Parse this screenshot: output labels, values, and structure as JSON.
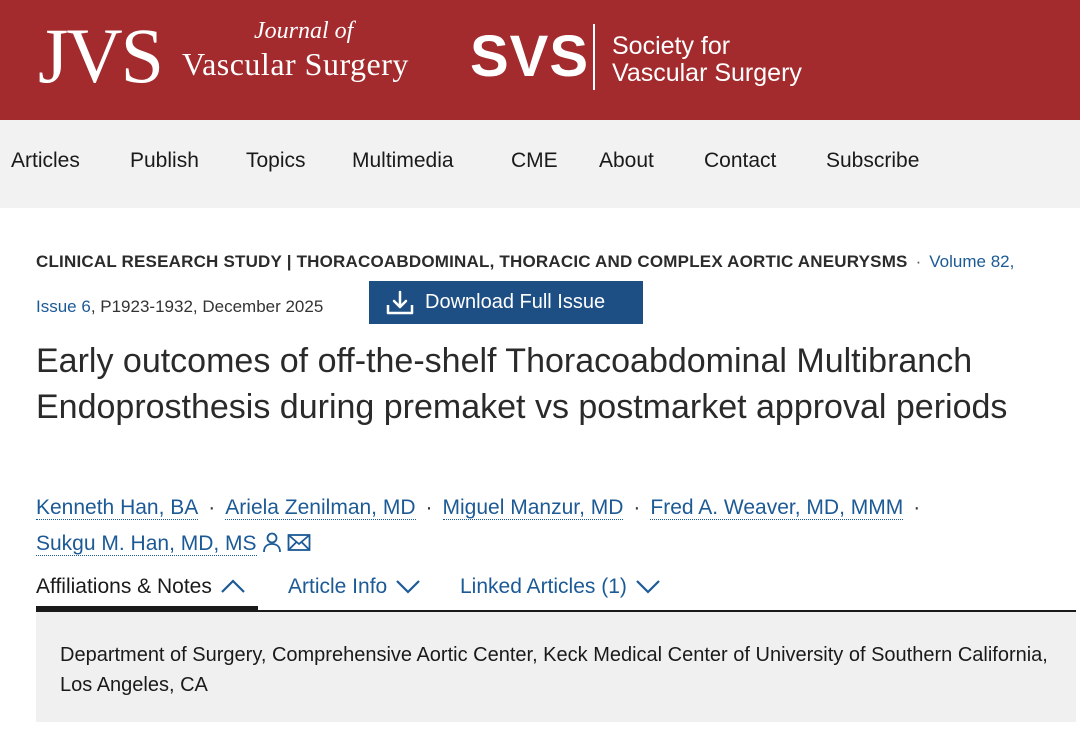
{
  "header": {
    "journal_mark": "JVS",
    "journal_name_line1": "Journal of",
    "journal_name_line2": "Vascular Surgery",
    "society_mark": "SVS",
    "society_name_line1": "Society for",
    "society_name_line2": "Vascular Surgery",
    "brand_color": "#a32b2e"
  },
  "nav": {
    "items": [
      {
        "label": "Articles"
      },
      {
        "label": "Publish"
      },
      {
        "label": "Topics"
      },
      {
        "label": "Multimedia"
      },
      {
        "label": "CME"
      },
      {
        "label": "About"
      },
      {
        "label": "Contact"
      },
      {
        "label": "Subscribe"
      }
    ]
  },
  "article": {
    "category": "CLINICAL RESEARCH STUDY | THORACOABDOMINAL, THORACIC AND COMPLEX AORTIC ANEURYSMS",
    "separator": "·",
    "volume_link": "Volume 82,",
    "issue_link": "Issue 6",
    "pages_date": ", P1923-1932, December 2025",
    "download_button": "Download Full Issue",
    "title": "Early outcomes of off-the-shelf Thoracoabdominal Multibranch Endoprosthesis during premaket vs postmarket approval periods",
    "authors": [
      {
        "name": "Kenneth Han, BA"
      },
      {
        "name": "Ariela Zenilman, MD"
      },
      {
        "name": "Miguel Manzur, MD"
      },
      {
        "name": "Fred A. Weaver, MD, MMM"
      },
      {
        "name": "Sukgu M. Han, MD, MS"
      }
    ],
    "author_separator": "·",
    "link_color": "#1c5a96",
    "button_color": "#1d4f85"
  },
  "tabs": [
    {
      "label": "Affiliations & Notes",
      "icon": "chevron-up-icon",
      "active": true
    },
    {
      "label": "Article Info",
      "icon": "chevron-down-icon",
      "active": false
    },
    {
      "label": "Linked Articles (1)",
      "icon": "chevron-down-icon",
      "active": false
    }
  ],
  "affiliations": {
    "text": "Department of Surgery, Comprehensive Aortic Center, Keck Medical Center of University of Southern California, Los Angeles, CA"
  }
}
